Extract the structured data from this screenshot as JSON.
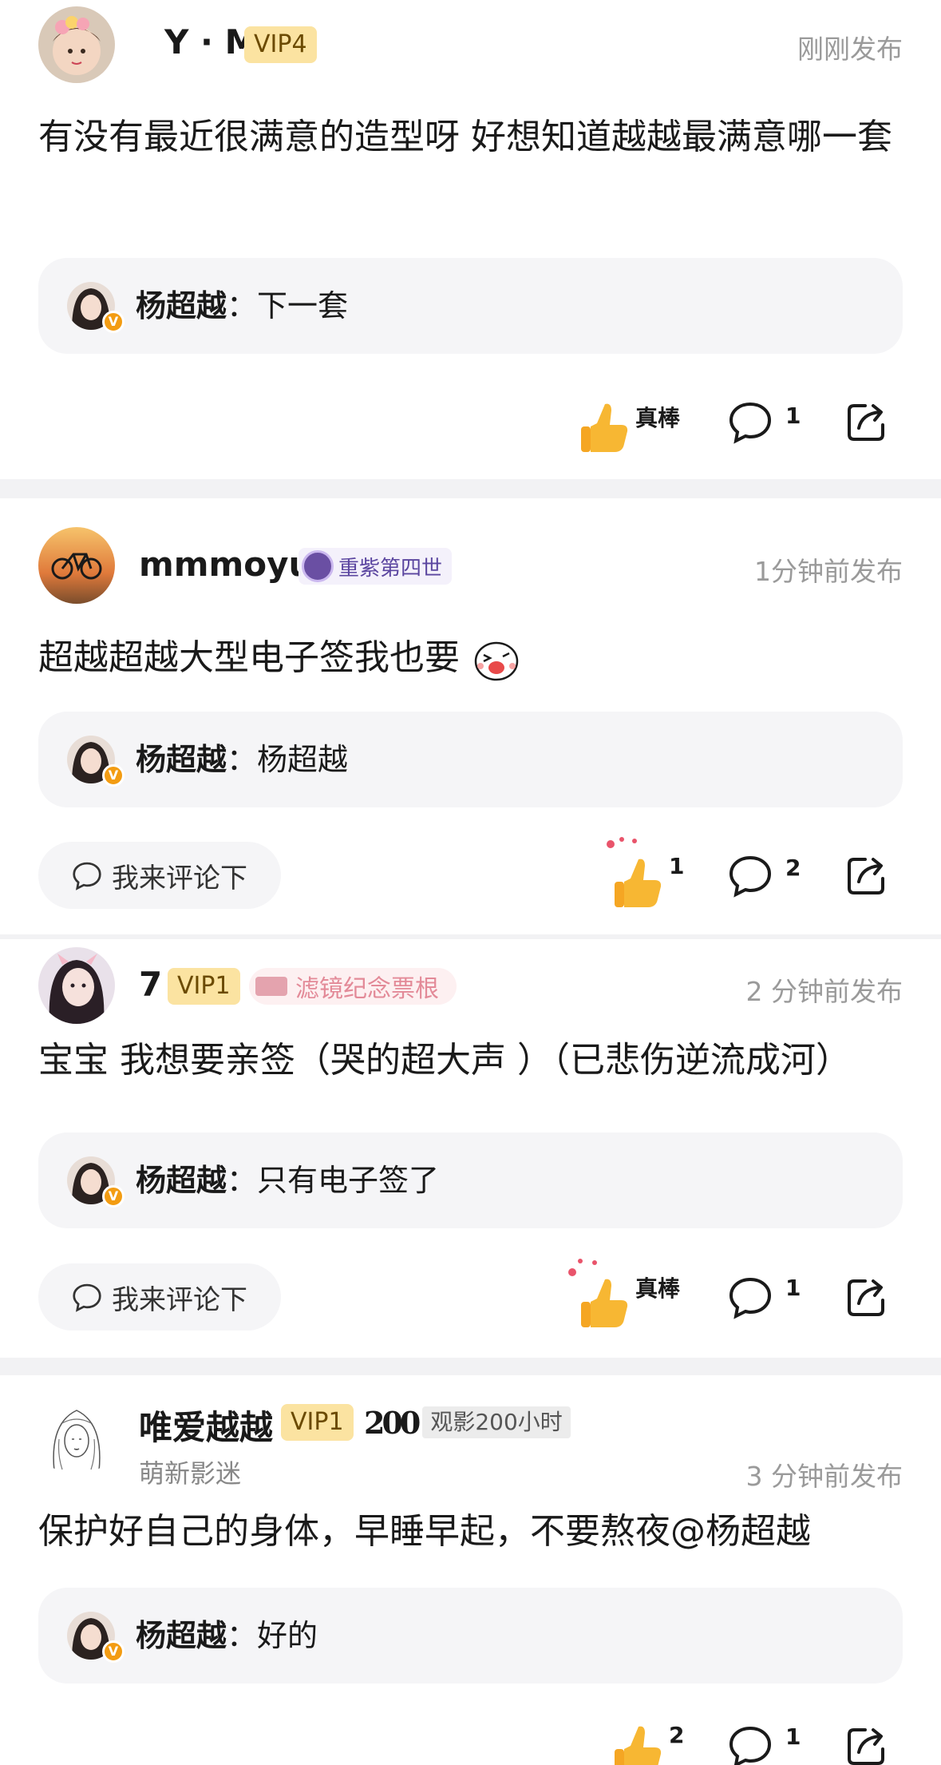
{
  "posts": [
    {
      "username": "Y · M",
      "vip": "VIP4",
      "time": "刚刚发布",
      "content": "有没有最近很满意的造型呀 好想知道越越最满意哪一套",
      "reply": {
        "name": "杨超越",
        "sep": "：",
        "text": "下一套"
      },
      "like_label": "真棒",
      "comment_count": "1"
    },
    {
      "username": "mmmoyu",
      "medal": "重紫第四世",
      "time": "1分钟前发布",
      "content": "超越超越大型电子签我也要",
      "reply": {
        "name": "杨超越",
        "sep": "：",
        "text": "杨超越"
      },
      "comment_button": "我来评论下",
      "like_count": "1",
      "comment_count": "2"
    },
    {
      "username": "7",
      "vip": "VIP1",
      "medal": "滤镜纪念票根",
      "time": "2 分钟前发布",
      "content": "宝宝 我想要亲签（哭的超大声 ）（已悲伤逆流成河）",
      "reply": {
        "name": "杨超越",
        "sep": "：",
        "text": "只有电子签了"
      },
      "comment_button": "我来评论下",
      "like_label": "真棒",
      "comment_count": "1"
    },
    {
      "username": "唯爱越越",
      "vip": "VIP1",
      "medal_prefix": "200",
      "medal": "观影200小时",
      "subtitle": "萌新影迷",
      "time": "3 分钟前发布",
      "content": "保护好自己的身体，早睡早起，不要熬夜@杨超越",
      "reply": {
        "name": "杨超越",
        "sep": "：",
        "text": "好的"
      },
      "like_count": "2",
      "comment_count": "1"
    }
  ],
  "icons": {
    "like": "thumbs-up-icon",
    "comment": "comment-bubble-icon",
    "share": "share-icon",
    "verified": "verified-v-icon"
  },
  "colors": {
    "vip_bg": "#fbe3a1",
    "reply_bg": "#f5f5f7",
    "divider": "#f2f2f4",
    "verified": "#f39c12"
  }
}
